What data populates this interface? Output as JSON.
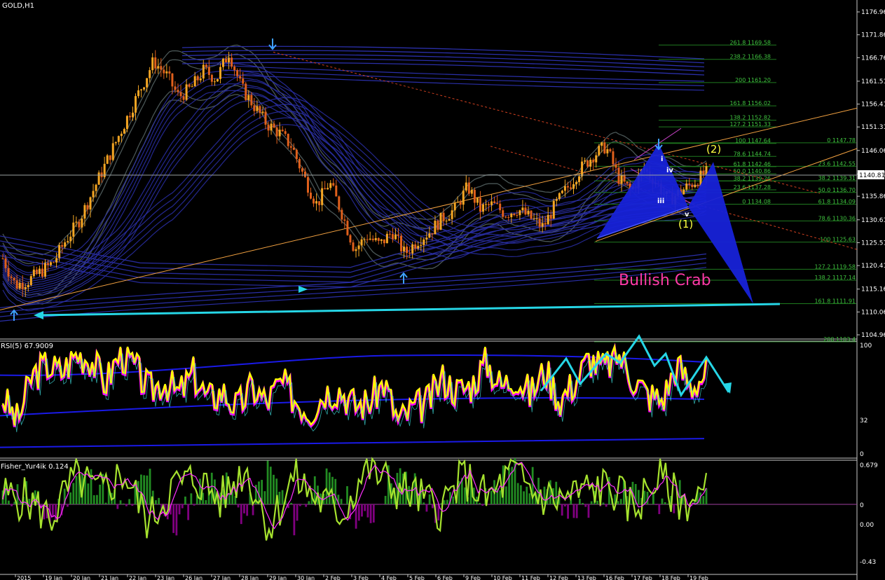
{
  "window": {
    "symbol_label": "GOLD,H1"
  },
  "colors": {
    "background": "#000000",
    "bull_candle": "#f5a623",
    "bear_candle": "#e0601c",
    "ma_band": "#2a2fa8",
    "envelope": "#4a5656",
    "fib_line": "#1f7a1f",
    "fib_text": "#3fc23f",
    "pattern_fill": "#1722d8",
    "trend_orange": "#f0a040",
    "trend_red_dash": "#d04020",
    "cyan": "#26d6e6",
    "rsi_main": "#ffff00",
    "rsi_magenta": "#ff00ff",
    "rsi_band": "#1a1ae8",
    "fisher_line": "#a6e22e",
    "fisher_signal": "#ff30ff",
    "hist_pos": "#228b22",
    "hist_neg": "#800080",
    "label_magenta": "#ff3aa8",
    "wave_yellow": "#ffff40",
    "price_box": "#ffffff"
  },
  "price_axis": {
    "ticks": [
      "1176.96",
      "1171.86",
      "1166.76",
      "1161.51",
      "1156.41",
      "1151.31",
      "1146.06",
      "1140.81",
      "1135.86",
      "1130.61",
      "1125.51",
      "1120.41",
      "1115.16",
      "1110.06",
      "1104.96"
    ],
    "current_price": "1140.81"
  },
  "fib_levels_upper": [
    {
      "label": "261.8 1169.58"
    },
    {
      "label": "238.2 1166.38"
    },
    {
      "label": "200 1161.20"
    },
    {
      "label": "161.8 1156.02"
    },
    {
      "label": "138.2 1152.82"
    },
    {
      "label": "127.2 1151.33"
    },
    {
      "label": "100 1147.64"
    },
    {
      "label": "78.6 1144.74"
    },
    {
      "label": "61.8 1142.46"
    },
    {
      "label": "50.0 1140.86"
    },
    {
      "label": "38.2 1139.26"
    },
    {
      "label": "23.6 1137.28"
    },
    {
      "label": "0 1134.08"
    }
  ],
  "fib_levels_lower": [
    {
      "label": "0 1147.78"
    },
    {
      "label": "23.6 1142.55"
    },
    {
      "label": "38.2 1139.31"
    },
    {
      "label": "50.0 1136.70"
    },
    {
      "label": "61.8 1134.09"
    },
    {
      "label": "78.6 1130.36"
    },
    {
      "label": "100 1125.63"
    },
    {
      "label": "127.2 1119.58"
    },
    {
      "label": "138.2 1117.14"
    },
    {
      "label": "161.8 1111.91"
    },
    {
      "label": "200 1103.4"
    }
  ],
  "pattern_label": "Bullish Crab",
  "wave_labels": {
    "w1": "(1)",
    "w2": "(2)",
    "i": "i",
    "iii": "iii",
    "iv": "iv",
    "v": "v"
  },
  "rsi_panel": {
    "title": "RSI(5) 67.9009",
    "ticks": [
      "100",
      "32",
      "0"
    ]
  },
  "fisher_panel": {
    "title": "Fisher_Yur4ik 0.124",
    "ticks": [
      "0.679",
      "0",
      "0.00",
      "-0.43"
    ]
  },
  "time_axis": {
    "labels": [
      "2015",
      "19 Jan",
      "20 Jan",
      "21 Jan",
      "22 Jan",
      "23 Jan",
      "26 Jan",
      "27 Jan",
      "28 Jan",
      "29 Jan",
      "30 Jan",
      "2 Feb",
      "3 Feb",
      "4 Feb",
      "5 Feb",
      "6 Feb",
      "9 Feb",
      "10 Feb",
      "11 Feb",
      "12 Feb",
      "13 Feb",
      "16 Feb",
      "17 Feb",
      "18 Feb",
      "19 Feb"
    ]
  },
  "chart_data": {
    "type": "candlestick",
    "title": "GOLD,H1",
    "ylim": [
      1104.96,
      1176.96
    ],
    "price_path": [
      1122,
      1116,
      1117,
      1119,
      1121,
      1126,
      1130,
      1136,
      1142,
      1148,
      1154,
      1160,
      1166,
      1163,
      1158,
      1160,
      1164,
      1162,
      1168,
      1160,
      1156,
      1152,
      1150,
      1147,
      1140,
      1134,
      1139,
      1132,
      1124,
      1127,
      1125,
      1128,
      1123,
      1126,
      1128,
      1131,
      1133,
      1138,
      1133,
      1134,
      1132,
      1133,
      1131,
      1129,
      1134,
      1138,
      1142,
      1145,
      1147,
      1140,
      1137,
      1142,
      1139,
      1135,
      1137,
      1139,
      1141
    ],
    "rsi_path": [
      52,
      30,
      72,
      82,
      75,
      92,
      88,
      65,
      93,
      80,
      58,
      68,
      55,
      74,
      50,
      58,
      42,
      62,
      48,
      66,
      50,
      40,
      58,
      60,
      45,
      48,
      66,
      30,
      42,
      48,
      70,
      58,
      64,
      85,
      62,
      72,
      55,
      78,
      50,
      66,
      88,
      78,
      92,
      70,
      55,
      50,
      82,
      62,
      75
    ],
    "fisher_path": [
      0.1,
      0.05,
      -0.15,
      0.3,
      0.12,
      0.35,
      -0.2,
      0.2,
      0.28,
      0.05,
      0.4,
      -0.25,
      0.3,
      0.05,
      -0.1,
      0.42,
      0.2,
      0.1,
      -0.05,
      0.3,
      0.05,
      0.35,
      0.1,
      0.05,
      0.15,
      0.2,
      -0.05,
      0.3,
      0.02,
      0.12
    ],
    "fisher_hist": [
      0.1,
      0.15,
      -0.2,
      0.3,
      0.25,
      -0.1,
      0.35,
      -0.3,
      0.15,
      0.28,
      -0.15,
      0.4,
      -0.2,
      0.3,
      0.1,
      -0.25,
      0.35,
      0.2,
      -0.15,
      0.25,
      0.1,
      0.38,
      0.22,
      0.05,
      -0.12,
      0.15,
      0.25,
      -0.08,
      0.12,
      0.18
    ]
  }
}
